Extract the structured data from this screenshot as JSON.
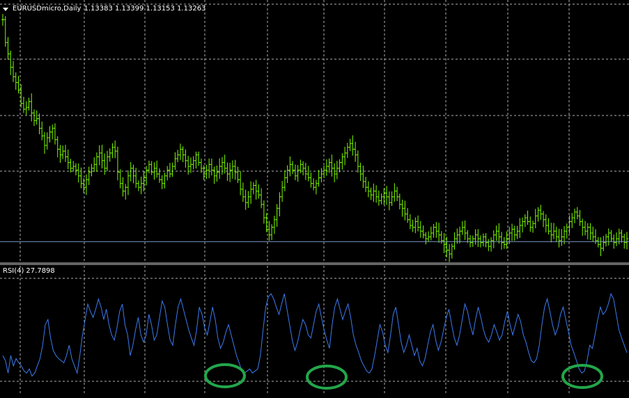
{
  "main_header": {
    "symbol": "EURUSDmicro,Daily",
    "ohlc": "1.13383 1.13399 1.13153 1.13263"
  },
  "rsi_header": {
    "name": "RSI(4)",
    "value": "27.7898"
  },
  "colors": {
    "background": "#000000",
    "candles": "#7cfc00",
    "rsi_line": "#3c7bf0",
    "grid": "#cfcfcf",
    "separator": "#c8c8c8",
    "price_line": "#7a9cc8",
    "highlight_ring": "#23a64a"
  },
  "chart_data": [
    {
      "type": "line",
      "description_ref": "main_header.symbol",
      "series": [
        {
          "values": [
            1.175,
            1.163,
            1.157,
            1.15,
            1.145,
            1.142,
            1.138,
            1.131,
            1.128,
            1.129,
            1.132,
            1.126,
            1.122,
            1.123,
            1.118,
            1.114,
            1.109,
            1.113,
            1.116,
            1.118,
            1.112,
            1.107,
            1.104,
            1.106,
            1.103,
            1.1,
            1.097,
            1.098,
            1.096,
            1.093,
            1.089,
            1.087,
            1.091,
            1.095,
            1.097,
            1.099,
            1.103,
            1.105,
            1.101,
            1.097,
            1.103,
            1.105,
            1.108,
            1.106,
            1.095,
            1.089,
            1.085,
            1.087,
            1.093,
            1.097,
            1.093,
            1.089,
            1.087,
            1.089,
            1.092,
            1.096,
            1.099,
            1.095,
            1.097,
            1.094,
            1.091,
            1.089,
            1.093,
            1.096,
            1.094,
            1.098,
            1.102,
            1.104,
            1.107,
            1.104,
            1.101,
            1.098,
            1.099,
            1.101,
            1.104,
            1.1,
            1.097,
            1.094,
            1.096,
            1.099,
            1.096,
            1.093,
            1.095,
            1.098,
            1.1,
            1.097,
            1.094,
            1.096,
            1.098,
            1.095,
            1.091,
            1.086,
            1.082,
            1.079,
            1.082,
            1.086,
            1.088,
            1.085,
            1.083,
            1.078,
            1.071,
            1.065,
            1.062,
            1.066,
            1.07,
            1.076,
            1.082,
            1.087,
            1.092,
            1.096,
            1.099,
            1.096,
            1.093,
            1.096,
            1.099,
            1.097,
            1.094,
            1.092,
            1.089,
            1.087,
            1.089,
            1.092,
            1.094,
            1.096,
            1.098,
            1.1,
            1.097,
            1.094,
            1.097,
            1.1,
            1.103,
            1.105,
            1.108,
            1.11,
            1.107,
            1.104,
            1.098,
            1.094,
            1.09,
            1.087,
            1.085,
            1.083,
            1.085,
            1.082,
            1.08,
            1.082,
            1.084,
            1.082,
            1.079,
            1.082,
            1.085,
            1.082,
            1.078,
            1.076,
            1.073,
            1.07,
            1.067,
            1.066,
            1.069,
            1.066,
            1.064,
            1.062,
            1.06,
            1.061,
            1.063,
            1.066,
            1.064,
            1.062,
            1.059,
            1.057,
            1.054,
            1.052,
            1.056,
            1.06,
            1.062,
            1.064,
            1.066,
            1.063,
            1.06,
            1.058,
            1.06,
            1.062,
            1.06,
            1.058,
            1.061,
            1.058,
            1.056,
            1.059,
            1.062,
            1.064,
            1.061,
            1.058,
            1.057,
            1.06,
            1.063,
            1.065,
            1.062,
            1.064,
            1.067,
            1.069,
            1.071,
            1.069,
            1.066,
            1.068,
            1.072,
            1.075,
            1.073,
            1.07,
            1.067,
            1.064,
            1.062,
            1.064,
            1.061,
            1.059,
            1.061,
            1.064,
            1.066,
            1.069,
            1.071,
            1.074,
            1.072,
            1.069,
            1.066,
            1.064,
            1.066,
            1.063,
            1.061,
            1.059,
            1.057,
            1.055,
            1.058,
            1.061,
            1.063,
            1.06,
            1.058,
            1.06,
            1.063,
            1.061,
            1.058,
            1.06
          ]
        }
      ],
      "price_line": 1.0585,
      "candles": "bar-chart style OHLC bars"
    },
    {
      "type": "line",
      "description_ref": "rsi_header.name",
      "ylim": [
        0,
        100
      ],
      "levels": [
        30,
        70
      ],
      "series": [
        {
          "values": [
            25,
            20,
            8,
            25,
            15,
            22,
            18,
            15,
            10,
            8,
            12,
            5,
            8,
            15,
            22,
            35,
            55,
            60,
            42,
            30,
            25,
            22,
            20,
            18,
            25,
            35,
            22,
            15,
            8,
            25,
            45,
            60,
            75,
            68,
            62,
            70,
            80,
            72,
            60,
            70,
            55,
            45,
            40,
            52,
            68,
            75,
            55,
            45,
            25,
            35,
            50,
            62,
            45,
            38,
            45,
            65,
            55,
            40,
            45,
            62,
            78,
            72,
            55,
            40,
            35,
            55,
            72,
            80,
            70,
            60,
            50,
            42,
            35,
            50,
            72,
            65,
            52,
            45,
            58,
            72,
            60,
            42,
            32,
            38,
            48,
            55,
            45,
            35,
            25,
            18,
            10,
            8,
            10,
            12,
            8,
            10,
            12,
            25,
            50,
            72,
            82,
            85,
            80,
            72,
            65,
            75,
            85,
            70,
            55,
            40,
            30,
            38,
            50,
            60,
            55,
            45,
            42,
            55,
            68,
            75,
            62,
            50,
            40,
            32,
            55,
            72,
            80,
            70,
            60,
            68,
            75,
            62,
            45,
            35,
            28,
            20,
            15,
            10,
            8,
            12,
            25,
            40,
            55,
            48,
            35,
            28,
            45,
            65,
            72,
            55,
            38,
            28,
            35,
            45,
            35,
            25,
            32,
            20,
            15,
            22,
            35,
            48,
            55,
            40,
            30,
            38,
            50,
            62,
            70,
            55,
            42,
            35,
            45,
            60,
            75,
            68,
            55,
            45,
            60,
            72,
            62,
            50,
            42,
            38,
            45,
            55,
            48,
            40,
            45,
            58,
            68,
            55,
            45,
            55,
            65,
            58,
            45,
            38,
            28,
            20,
            18,
            22,
            35,
            55,
            72,
            80,
            68,
            55,
            45,
            52,
            65,
            72,
            60,
            48,
            35,
            28,
            20,
            12,
            8,
            10,
            20,
            35,
            32,
            45,
            60,
            72,
            65,
            68,
            75,
            85,
            80,
            65,
            50,
            42,
            35,
            27.79
          ]
        }
      ]
    }
  ]
}
